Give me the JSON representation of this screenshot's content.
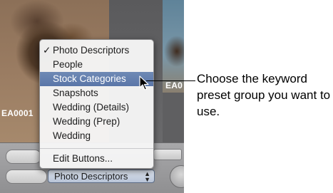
{
  "photos": {
    "left_label": "EA0001",
    "right_label": "EA0"
  },
  "popup": {
    "selected_value": "Photo Descriptors",
    "arrows": "▲▼"
  },
  "menu": {
    "items": [
      {
        "label": "Photo Descriptors",
        "checked": true,
        "highlighted": false
      },
      {
        "label": "People",
        "checked": false,
        "highlighted": false
      },
      {
        "label": "Stock Categories",
        "checked": false,
        "highlighted": true
      },
      {
        "label": "Snapshots",
        "checked": false,
        "highlighted": false
      },
      {
        "label": "Wedding (Details)",
        "checked": false,
        "highlighted": false
      },
      {
        "label": "Wedding (Prep)",
        "checked": false,
        "highlighted": false
      },
      {
        "label": "Wedding",
        "checked": false,
        "highlighted": false
      }
    ],
    "edit_item": "Edit Buttons...",
    "checkmark": "✓"
  },
  "callout": {
    "text": "Choose the keyword preset group you want to use."
  },
  "colors": {
    "highlight": "#5a76a8",
    "menu_background": "#f6f6f6",
    "screen_background": "#5f5f61"
  }
}
